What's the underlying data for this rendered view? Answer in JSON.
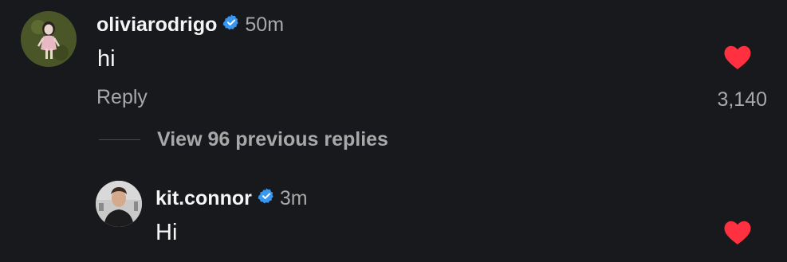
{
  "comment": {
    "username": "oliviarodrigo",
    "time": "50m",
    "text": "hi",
    "reply_label": "Reply",
    "like_count": "3,140",
    "verified_icon": "verified-badge-icon",
    "like_icon": "heart-icon"
  },
  "view_replies": {
    "label": "View 96 previous replies"
  },
  "reply": {
    "username": "kit.connor",
    "time": "3m",
    "text": "Hi",
    "verified_icon": "verified-badge-icon",
    "like_icon": "heart-icon"
  },
  "colors": {
    "background": "#18191d",
    "primary_text": "#f5f5f5",
    "secondary_text": "#a8a8a8",
    "verified_blue": "#3897f0",
    "like_red": "#ff3040"
  }
}
